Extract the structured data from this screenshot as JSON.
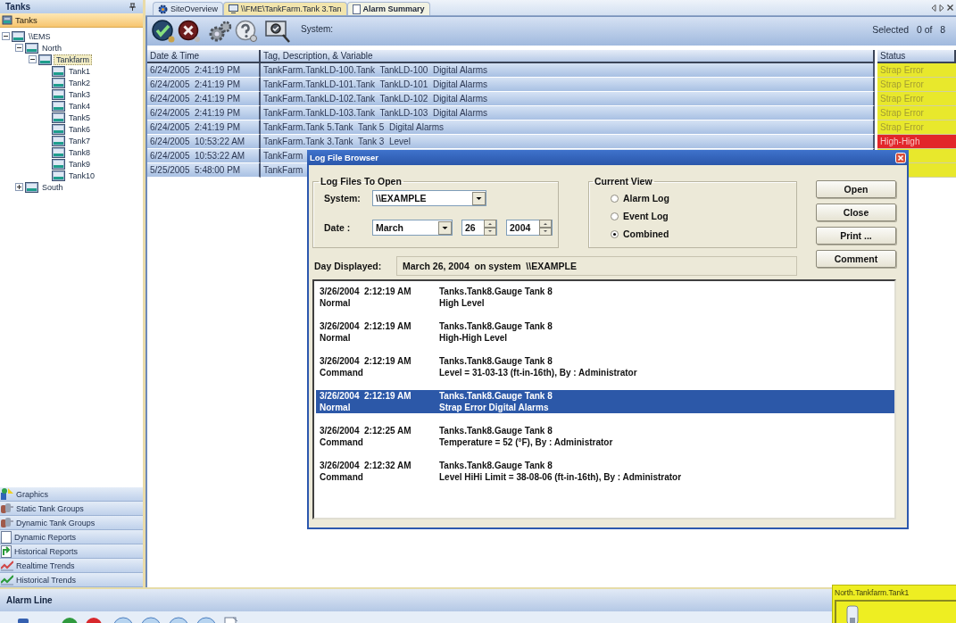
{
  "sidebar": {
    "title": "Tanks",
    "active_group": "Tanks",
    "tree": [
      {
        "label": "\\\\EMS",
        "expanded": true,
        "selected": false,
        "children": [
          {
            "label": "North",
            "expanded": true,
            "selected": false,
            "children": [
              {
                "label": "Tankfarm",
                "expanded": true,
                "selected": true,
                "children": [
                  {
                    "label": "Tank1",
                    "selected": false
                  },
                  {
                    "label": "Tank2",
                    "selected": false
                  },
                  {
                    "label": "Tank3",
                    "selected": false
                  },
                  {
                    "label": "Tank4",
                    "selected": false
                  },
                  {
                    "label": "Tank5",
                    "selected": false
                  },
                  {
                    "label": "Tank6",
                    "selected": false
                  },
                  {
                    "label": "Tank7",
                    "selected": false
                  },
                  {
                    "label": "Tank8",
                    "selected": false
                  },
                  {
                    "label": "Tank9",
                    "selected": false
                  },
                  {
                    "label": "Tank10",
                    "selected": false
                  }
                ]
              }
            ]
          },
          {
            "label": "South",
            "expanded": false,
            "selected": false
          }
        ]
      }
    ],
    "nav_items": [
      {
        "label": "Graphics"
      },
      {
        "label": "Static Tank Groups"
      },
      {
        "label": "Dynamic Tank Groups"
      },
      {
        "label": "Dynamic Reports"
      },
      {
        "label": "Historical Reports"
      },
      {
        "label": "Realtime Trends"
      },
      {
        "label": "Historical Trends"
      }
    ]
  },
  "tabs": [
    {
      "label": "SiteOverview",
      "selected": false,
      "highlighted": false
    },
    {
      "label": "\\\\FME\\TankFarm.Tank 3.Tan",
      "selected": false,
      "highlighted": true
    },
    {
      "label": "Alarm Summary",
      "selected": true,
      "highlighted": false
    }
  ],
  "toolbar": {
    "system_label": "System:",
    "selection": "Selected   0 of   8"
  },
  "table": {
    "columns": [
      "Date & Time",
      "Tag, Description, & Variable",
      "Status"
    ],
    "rows": [
      {
        "date_time": "6/24/2005  2:41:19 PM",
        "tag": "TankFarm.TankLD-100.Tank  TankLD-100  Digital Alarms",
        "status": "Strap Error",
        "color": "#e8e82c"
      },
      {
        "date_time": "6/24/2005  2:41:19 PM",
        "tag": "TankFarm.TankLD-101.Tank  TankLD-101  Digital Alarms",
        "status": "Strap Error",
        "color": "#e8e82c"
      },
      {
        "date_time": "6/24/2005  2:41:19 PM",
        "tag": "TankFarm.TankLD-102.Tank  TankLD-102  Digital Alarms",
        "status": "Strap Error",
        "color": "#e8e82c"
      },
      {
        "date_time": "6/24/2005  2:41:19 PM",
        "tag": "TankFarm.TankLD-103.Tank  TankLD-103  Digital Alarms",
        "status": "Strap Error",
        "color": "#e8e82c"
      },
      {
        "date_time": "6/24/2005  2:41:19 PM",
        "tag": "TankFarm.Tank 5.Tank  Tank 5  Digital Alarms",
        "status": "Strap Error",
        "color": "#e8e82c"
      },
      {
        "date_time": "6/24/2005  10:53:22 AM",
        "tag": "TankFarm.Tank 3.Tank  Tank 3  Level",
        "status": "High-High",
        "color": "#e2262a"
      },
      {
        "date_time": "6/24/2005  10:53:22 AM",
        "tag": "TankFarm",
        "color": "#e8e82c"
      },
      {
        "date_time": "5/25/2005  5:48:00 PM",
        "tag": "TankFarm",
        "color": "#e8e82c"
      }
    ]
  },
  "dialog": {
    "title": "Log File Browser",
    "log_files": {
      "title": "Log Files To Open",
      "system_label": "System:",
      "system": "\\\\EXAMPLE",
      "date_label": "Date :",
      "month": "March",
      "day": "26",
      "year": "2004"
    },
    "current_view": {
      "title": "Current View",
      "options": [
        {
          "label": "Alarm Log",
          "selected": false
        },
        {
          "label": "Event Log",
          "selected": false
        },
        {
          "label": "Combined",
          "selected": true
        }
      ]
    },
    "buttons": [
      "Open",
      "Close",
      "Print ...",
      "Comment"
    ],
    "day_displayed_label": "Day Displayed:",
    "day_displayed": "March 26, 2004  on system  \\\\EXAMPLE",
    "entries": [
      {
        "date_time": "3/26/2004  2:12:19 AM",
        "type": "Normal",
        "tag": "Tanks.Tank8.Gauge Tank 8",
        "description": "High Level",
        "selected": false
      },
      {
        "date_time": "3/26/2004  2:12:19 AM",
        "type": "Normal",
        "tag": "Tanks.Tank8.Gauge Tank 8",
        "description": "High-High Level",
        "selected": false
      },
      {
        "date_time": "3/26/2004  2:12:19 AM",
        "type": "Command",
        "tag": "Tanks.Tank8.Gauge Tank 8",
        "description": "Level = 31-03-13 (ft-in-16th), By : Administrator",
        "selected": false
      },
      {
        "date_time": "3/26/2004  2:12:19 AM",
        "type": "Normal",
        "tag": "Tanks.Tank8.Gauge Tank 8",
        "description": "Strap Error Digital Alarms",
        "selected": true
      },
      {
        "date_time": "3/26/2004  2:12:25 AM",
        "type": "Command",
        "tag": "Tanks.Tank8.Gauge Tank 8",
        "description": "Temperature = 52 (°F), By : Administrator",
        "selected": false
      },
      {
        "date_time": "3/26/2004  2:12:32 AM",
        "type": "Command",
        "tag": "Tanks.Tank8.Gauge Tank 8",
        "description": "Level HiHi Limit = 38-08-06 (ft-in-16th), By : Administrator",
        "selected": false
      }
    ]
  },
  "alarm_line": {
    "title": "Alarm Line"
  },
  "popup": {
    "title": "North.Tankfarm.Tank1"
  }
}
